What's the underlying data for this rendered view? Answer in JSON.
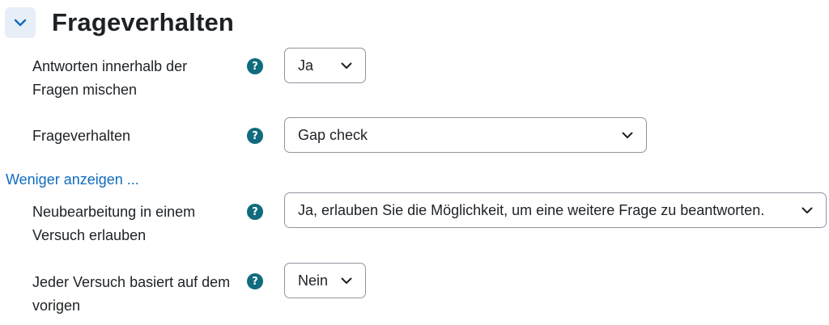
{
  "section": {
    "title": "Frageverhalten",
    "toggle_icon": "chevron-down-icon"
  },
  "fields": {
    "shuffle_answers": {
      "label_line1": "Antworten innerhalb der",
      "label_line2": "Fragen mischen",
      "help_icon": "?",
      "value": "Ja"
    },
    "question_behaviour": {
      "label": "Frageverhalten",
      "help_icon": "?",
      "value": "Gap check"
    },
    "redo_question": {
      "label_line1": "Neubearbeitung in einem",
      "label_line2": "Versuch erlauben",
      "help_icon": "?",
      "value": "Ja, erlauben Sie die Möglichkeit, um eine weitere Frage zu beantworten."
    },
    "builds_on_last": {
      "label_line1": "Jeder Versuch basiert auf dem",
      "label_line2": "vorigen",
      "help_icon": "?",
      "value": "Nein"
    }
  },
  "show_less_link": "Weniger anzeigen ...",
  "colors": {
    "help_icon_bg": "#0f6b7d",
    "link": "#0f6cbf",
    "toggle_bg": "#e7eef7",
    "select_border": "#8f959e"
  }
}
